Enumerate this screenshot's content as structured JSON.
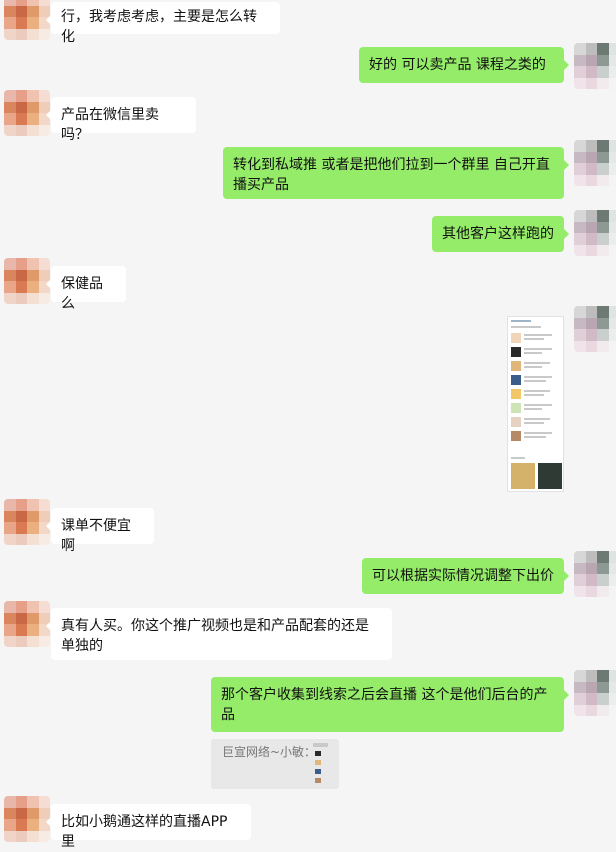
{
  "messages": [
    {
      "side": "in",
      "text": "行，我考虑考虑，主要是怎么转化"
    },
    {
      "side": "out",
      "text": "好的  可以卖产品  课程之类的"
    },
    {
      "side": "in",
      "text": "产品在微信里卖吗？"
    },
    {
      "side": "out",
      "text": "转化到私域推 或者是把他们拉到一个群里  自己开直播买产品"
    },
    {
      "side": "out",
      "text": "其他客户这样跑的"
    },
    {
      "side": "in",
      "text": "保健品么"
    },
    {
      "side": "out",
      "type": "image",
      "text": ""
    },
    {
      "side": "in",
      "text": "课单不便宜啊"
    },
    {
      "side": "out",
      "text": "可以根据实际情况调整下出价"
    },
    {
      "side": "in",
      "text": "真有人买。你这个推广视频也是和产品配套的还是单独的"
    },
    {
      "side": "out",
      "text": "那个客户收集到线索之后会直播  这个是他们后台的产品"
    },
    {
      "side": "in",
      "text": "比如小鹅通这样的直播APP里"
    }
  ],
  "quote": {
    "text": "巨宣网络~小敏："
  },
  "colors": {
    "background": "#f5f5f5",
    "outgoing": "#95ec69",
    "incoming": "#ffffff"
  }
}
